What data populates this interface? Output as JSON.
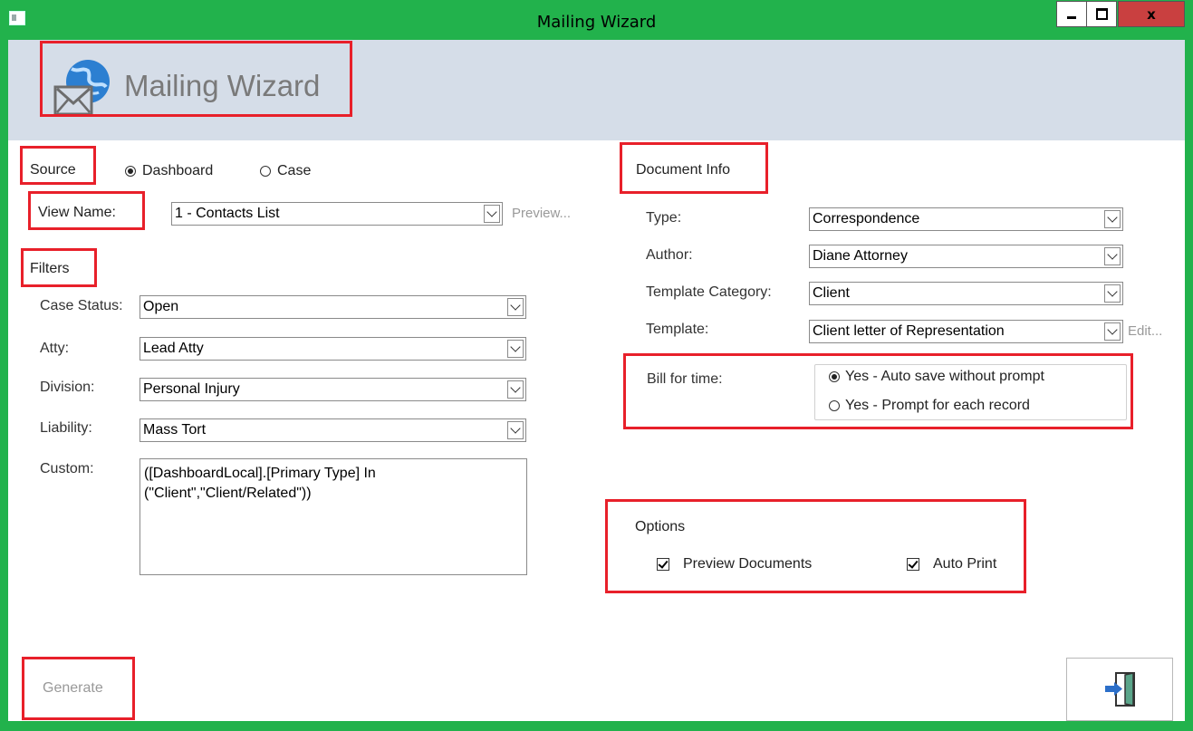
{
  "window": {
    "title": "Mailing Wizard",
    "close_label": "x"
  },
  "header": {
    "title": "Mailing Wizard",
    "logo_icon": "globe-envelope-icon"
  },
  "source": {
    "label": "Source",
    "options": [
      "Dashboard",
      "Case"
    ],
    "selected": "Dashboard"
  },
  "view": {
    "label": "View Name:",
    "value": "1 - Contacts List",
    "preview_link": "Preview..."
  },
  "filters": {
    "label": "Filters",
    "case_status": {
      "label": "Case Status:",
      "value": "Open"
    },
    "atty": {
      "label": "Atty:",
      "value": "Lead Atty"
    },
    "division": {
      "label": "Division:",
      "value": "Personal Injury"
    },
    "liability": {
      "label": "Liability:",
      "value": "Mass Tort"
    },
    "custom": {
      "label": "Custom:",
      "value": "([DashboardLocal].[Primary Type] In (\"Client\",\"Client/Related\"))"
    }
  },
  "document_info": {
    "label": "Document Info",
    "type": {
      "label": "Type:",
      "value": "Correspondence"
    },
    "author": {
      "label": "Author:",
      "value": "Diane Attorney"
    },
    "template_category": {
      "label": "Template Category:",
      "value": "Client"
    },
    "template": {
      "label": "Template:",
      "value": "Client letter of Representation",
      "edit_link": "Edit..."
    }
  },
  "bill_for_time": {
    "label": "Bill for time:",
    "options": [
      "Yes - Auto save without prompt",
      "Yes - Prompt for each record"
    ],
    "selected": "Yes - Auto save without prompt"
  },
  "options": {
    "label": "Options",
    "preview_documents": {
      "label": "Preview Documents",
      "checked": true
    },
    "auto_print": {
      "label": "Auto Print",
      "checked": true
    }
  },
  "actions": {
    "generate_label": "Generate",
    "exit_icon": "exit-door-icon"
  },
  "colors": {
    "window_frame": "#22b24c",
    "header_band": "#d5dde8",
    "highlight_box": "#e8202a",
    "close_button": "#c94040"
  }
}
